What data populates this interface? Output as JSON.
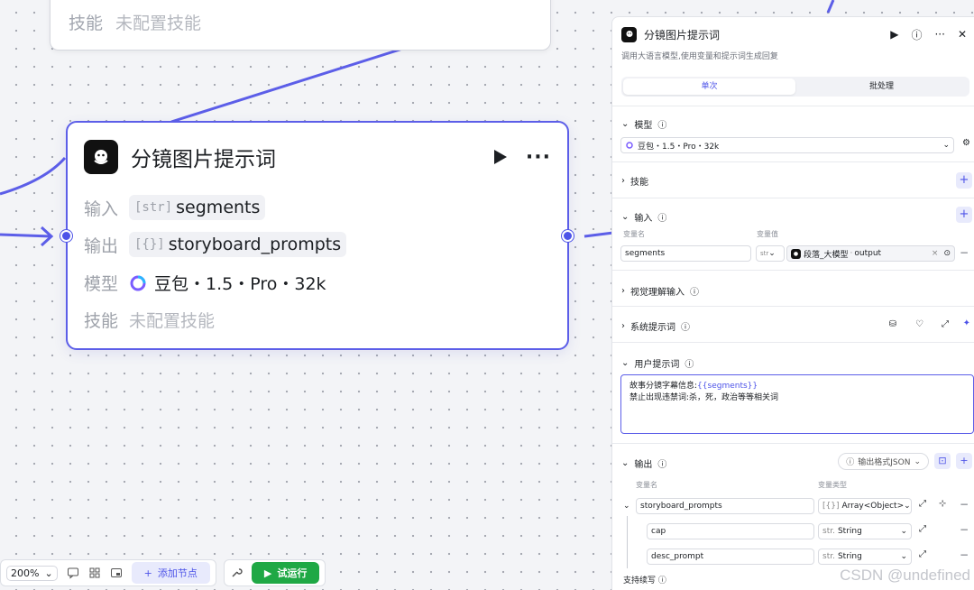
{
  "top_node": {
    "skill_label": "技能",
    "skill_value": "未配置技能"
  },
  "node": {
    "title": "分镜图片提示词",
    "input_label": "输入",
    "input_tag": "[str]",
    "input_value": "segments",
    "output_label": "输出",
    "output_tag": "[{}]",
    "output_value": "storyboard_prompts",
    "model_label": "模型",
    "model_value": "豆包・1.5・Pro・32k",
    "skill_label": "技能",
    "skill_value": "未配置技能"
  },
  "toolbar": {
    "zoom": "200%",
    "add_node": "添加节点",
    "run": "试运行"
  },
  "panel": {
    "title": "分镜图片提示词",
    "description": "调用大语言模型,使用变量和提示词生成回复",
    "tabs": [
      "单次",
      "批处理"
    ],
    "model": {
      "label": "模型",
      "value": "豆包・1.5・Pro・32k"
    },
    "skills": {
      "label": "技能"
    },
    "inputs": {
      "label": "输入",
      "col_name": "变量名",
      "col_value": "变量值",
      "name": "segments",
      "type": "str",
      "ref_source": "段落_大模型",
      "ref_var": "output"
    },
    "vision": {
      "label": "视觉理解输入"
    },
    "system_prompt": {
      "label": "系统提示词"
    },
    "user_prompt": {
      "label": "用户提示词",
      "line1_prefix": "故事分镜字幕信息:",
      "line1_var": "{{segments}}",
      "line2": "禁止出现违禁词:杀，死，政治等等相关词"
    },
    "outputs": {
      "label": "输出",
      "format_label": "输出格式JSON",
      "col_name": "变量名",
      "col_type": "变量类型",
      "rows": [
        {
          "name": "storyboard_prompts",
          "type_tag": "[{}]",
          "type": "Array<Object>"
        },
        {
          "name": "cap",
          "type_tag": "str.",
          "type": "String"
        },
        {
          "name": "desc_prompt",
          "type_tag": "str.",
          "type": "String"
        }
      ]
    },
    "continue_label": "支持续写"
  },
  "watermark": "CSDN @undefined"
}
